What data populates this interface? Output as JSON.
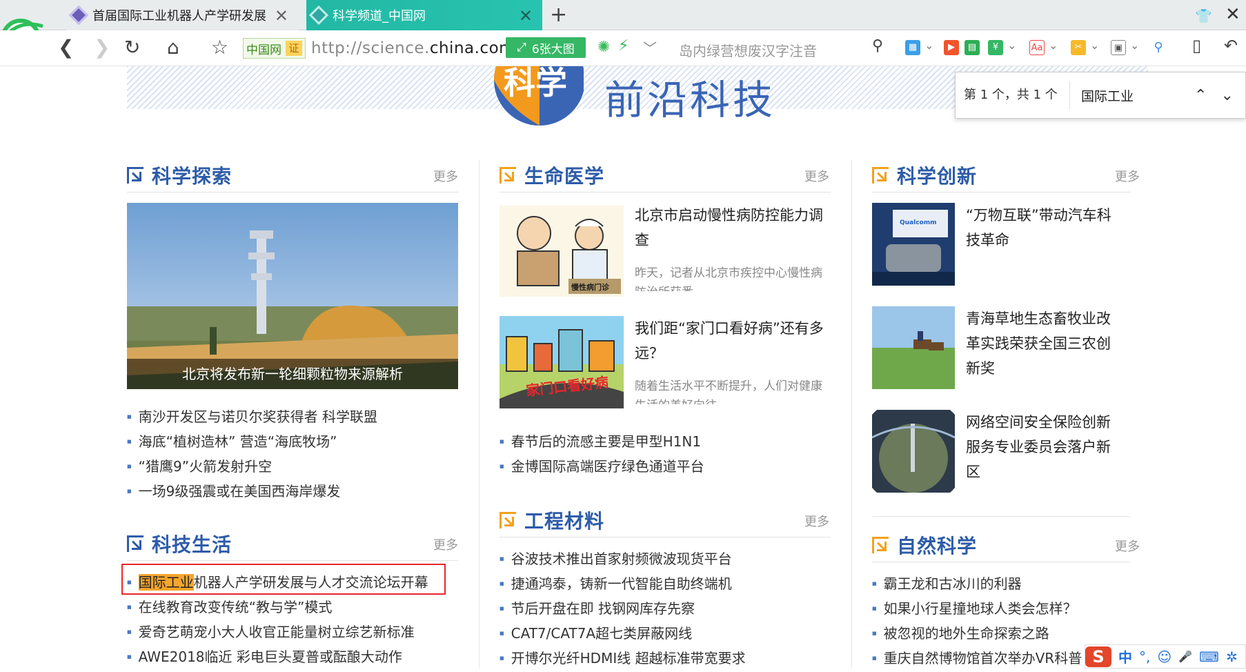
{
  "browser": {
    "tabs": [
      {
        "title": "首届国际工业机器人产学研发展",
        "active": false
      },
      {
        "title": "科学频道_中国网",
        "active": true
      }
    ],
    "new_tab_label": "+",
    "url_prefix": "http://science.",
    "url_domain": "china.com.",
    "cert_label": "中国网",
    "cert_badge": "证",
    "big_pic_label": "6张大图",
    "search_placeholder": "岛内绿营想废汉字注音",
    "icons": [
      "back-icon",
      "forward-icon",
      "refresh-icon",
      "home-icon",
      "star-icon",
      "search-icon",
      "apps-icon",
      "video-icon",
      "read-icon",
      "shield-icon",
      "translate-icon",
      "screenshot-icon",
      "game-icon",
      "zoom-icon",
      "sidebar-icon",
      "undo-icon"
    ]
  },
  "findbar": {
    "count": "第 1 个，共 1 个",
    "query": "国际工业",
    "prev": "︿",
    "next": "﹀"
  },
  "banner": {
    "logo_text": "科学",
    "title": "前沿科技"
  },
  "sections": {
    "explore": {
      "title": "科学探索",
      "more": "更多",
      "caption": "北京将发布新一轮细颗粒物来源解析",
      "items": [
        "南沙开发区与诺贝尔奖获得者 科学联盟",
        "海底“植树造林” 营造“海底牧场”",
        "“猎鹰9”火箭发射升空",
        "一场9级强震或在美国西海岸爆发"
      ]
    },
    "life": {
      "title": "科技生活",
      "more": "更多",
      "items": [
        {
          "hl": "国际工业",
          "rest": "机器人产学研发展与人才交流论坛开幕"
        },
        {
          "hl": "",
          "rest": "在线教育改变传统“教与学”模式"
        },
        {
          "hl": "",
          "rest": "爱奇艺萌宠小大人收官正能量树立综艺新标准"
        },
        {
          "hl": "",
          "rest": "AWE2018临近 彩电巨头夏普或酝酿大动作"
        }
      ]
    },
    "medicine": {
      "title": "生命医学",
      "more": "更多",
      "stories": [
        {
          "title": "北京市启动慢性病防控能力调查",
          "summary": "昨天，记者从北京市疾控中心慢性病防治所获悉"
        },
        {
          "title": "我们距“家门口看好病”还有多远？",
          "summary": "随着生活水平不断提升，人们对健康生活的美好向往"
        }
      ],
      "pic1_label": "慢性病门诊",
      "pic2_label": "家门口看好病",
      "items": [
        "春节后的流感主要是甲型H1N1",
        "金博国际高端医疗绿色通道平台"
      ]
    },
    "materials": {
      "title": "工程材料",
      "more": "更多",
      "items": [
        "谷波技术推出首家射频微波现货平台",
        "捷通鸿泰，铸新一代智能自助终端机",
        "节后开盘在即 找钢网库存先察",
        "CAT7/CAT7A超七类屏蔽网线",
        "开博尔光纤HDMI线 超越标准带宽要求"
      ]
    },
    "innovation": {
      "title": "科学创新",
      "more": "更多",
      "stories": [
        {
          "title": "“万物互联”带动汽车科技革命"
        },
        {
          "title": "青海草地生态畜牧业改革实践荣获全国三农创新奖"
        },
        {
          "title": "网络空间安全保险创新服务专业委员会落户新区"
        }
      ],
      "pic1_label": "Qualcomm"
    },
    "nature": {
      "title": "自然科学",
      "more": "更多",
      "items": [
        "霸王龙和古冰川的利器",
        "如果小行星撞地球人类会怎样？",
        "被忽视的地外生命探索之路",
        "重庆自然博物馆首次举办VR科普"
      ]
    }
  },
  "ime": {
    "logo": "S",
    "mode": "中",
    "punct": "°,",
    "emoji": "☺",
    "mic": "🎤",
    "kb": "⌨",
    "settings": "✲"
  }
}
